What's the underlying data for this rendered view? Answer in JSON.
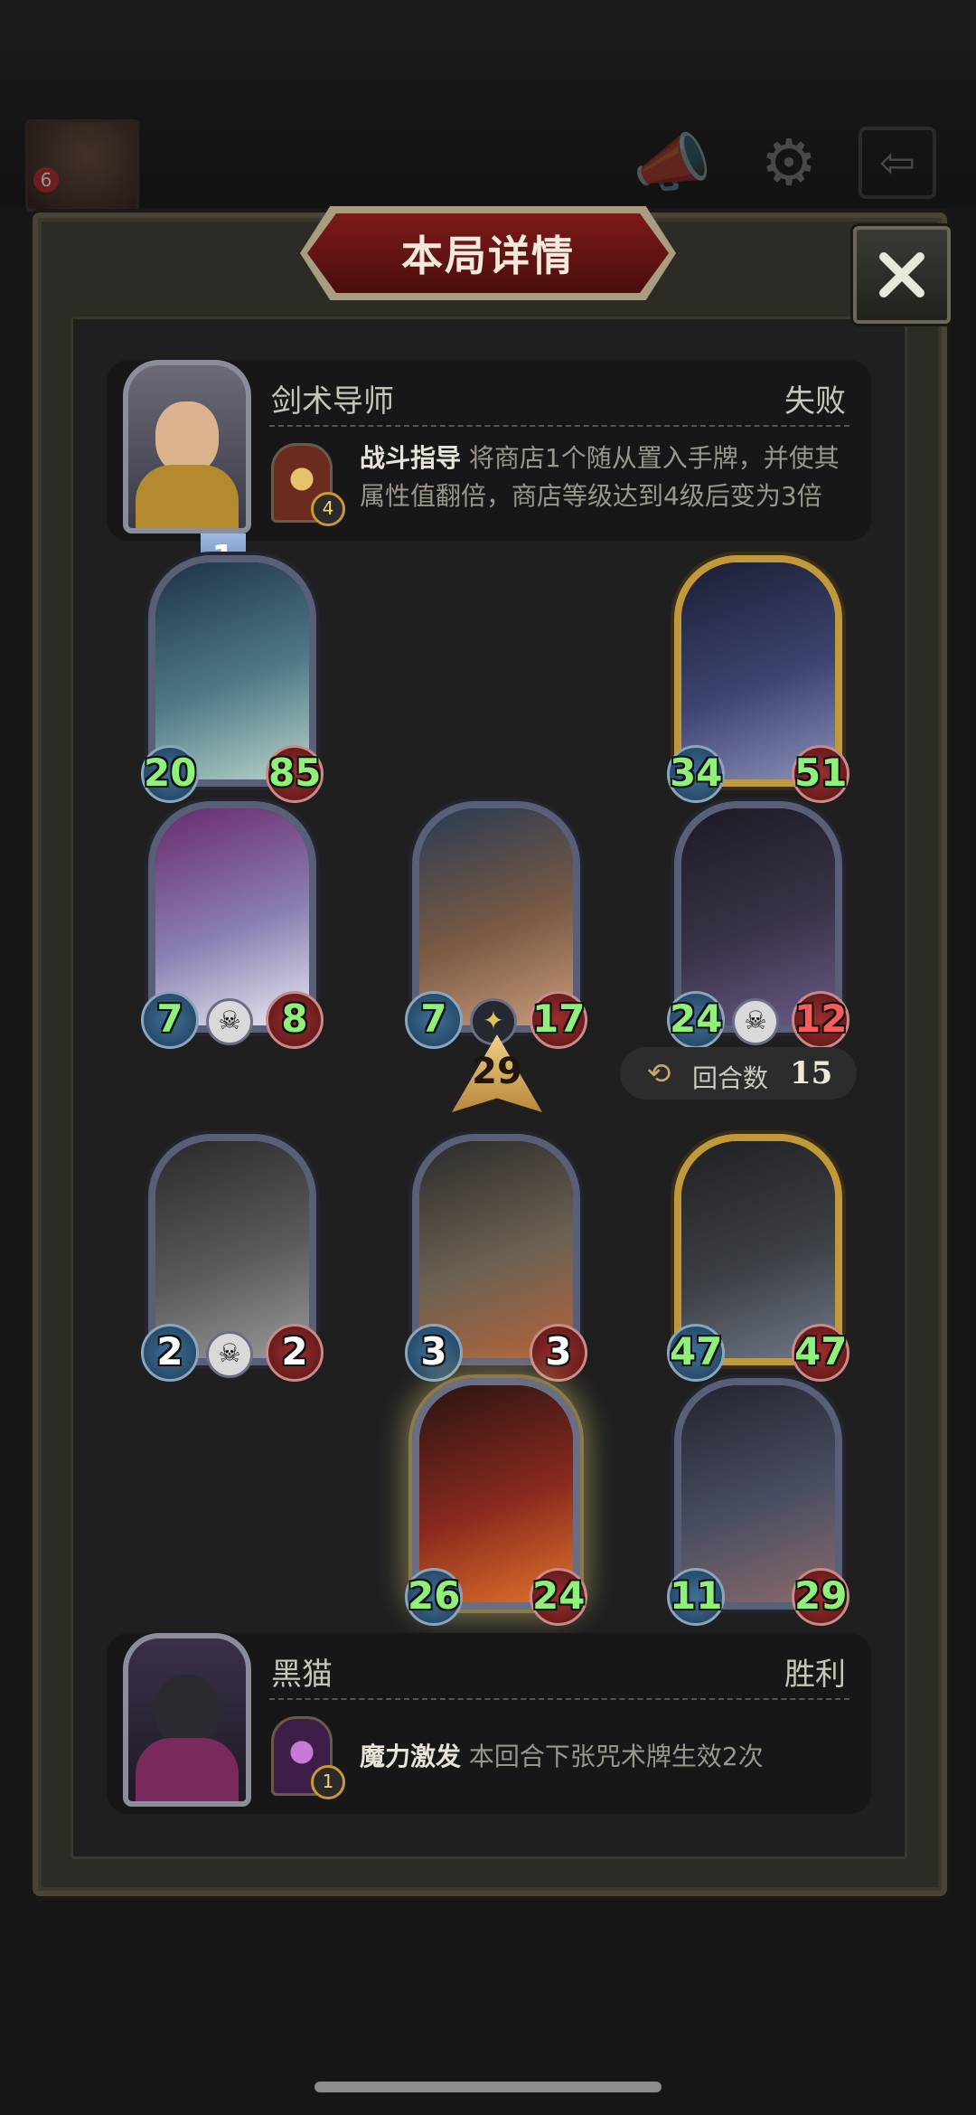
{
  "top_bar": {
    "avatar_level": "6"
  },
  "dialog": {
    "title": "本局详情"
  },
  "opponent": {
    "name": "剑术导师",
    "result": "失败",
    "skill_level": "4",
    "skill_name": "战斗指导",
    "skill_desc": "将商店1个随从置入手牌，并使其属性值翻倍，商店等级达到4级后变为3倍"
  },
  "rank": "1",
  "tier": "29",
  "round": {
    "label": "回合数",
    "value": "15"
  },
  "cards": [
    {
      "id": "card-1",
      "atk": "20",
      "hp": "85"
    },
    {
      "id": "card-2",
      "atk": "34",
      "hp": "51"
    },
    {
      "id": "card-3",
      "atk": "7",
      "hp": "8"
    },
    {
      "id": "card-4",
      "atk": "7",
      "hp": "17"
    },
    {
      "id": "card-5",
      "atk": "24",
      "hp": "12"
    },
    {
      "id": "card-6",
      "atk": "2",
      "hp": "2"
    },
    {
      "id": "card-7",
      "atk": "3",
      "hp": "3"
    },
    {
      "id": "card-8",
      "atk": "47",
      "hp": "47"
    },
    {
      "id": "card-9",
      "atk": "26",
      "hp": "24"
    },
    {
      "id": "card-10",
      "atk": "11",
      "hp": "29"
    }
  ],
  "player": {
    "name": "黑猫",
    "result": "胜利",
    "skill_level": "1",
    "skill_name": "魔力激发",
    "skill_desc": "本回合下张咒术牌生效2次"
  }
}
